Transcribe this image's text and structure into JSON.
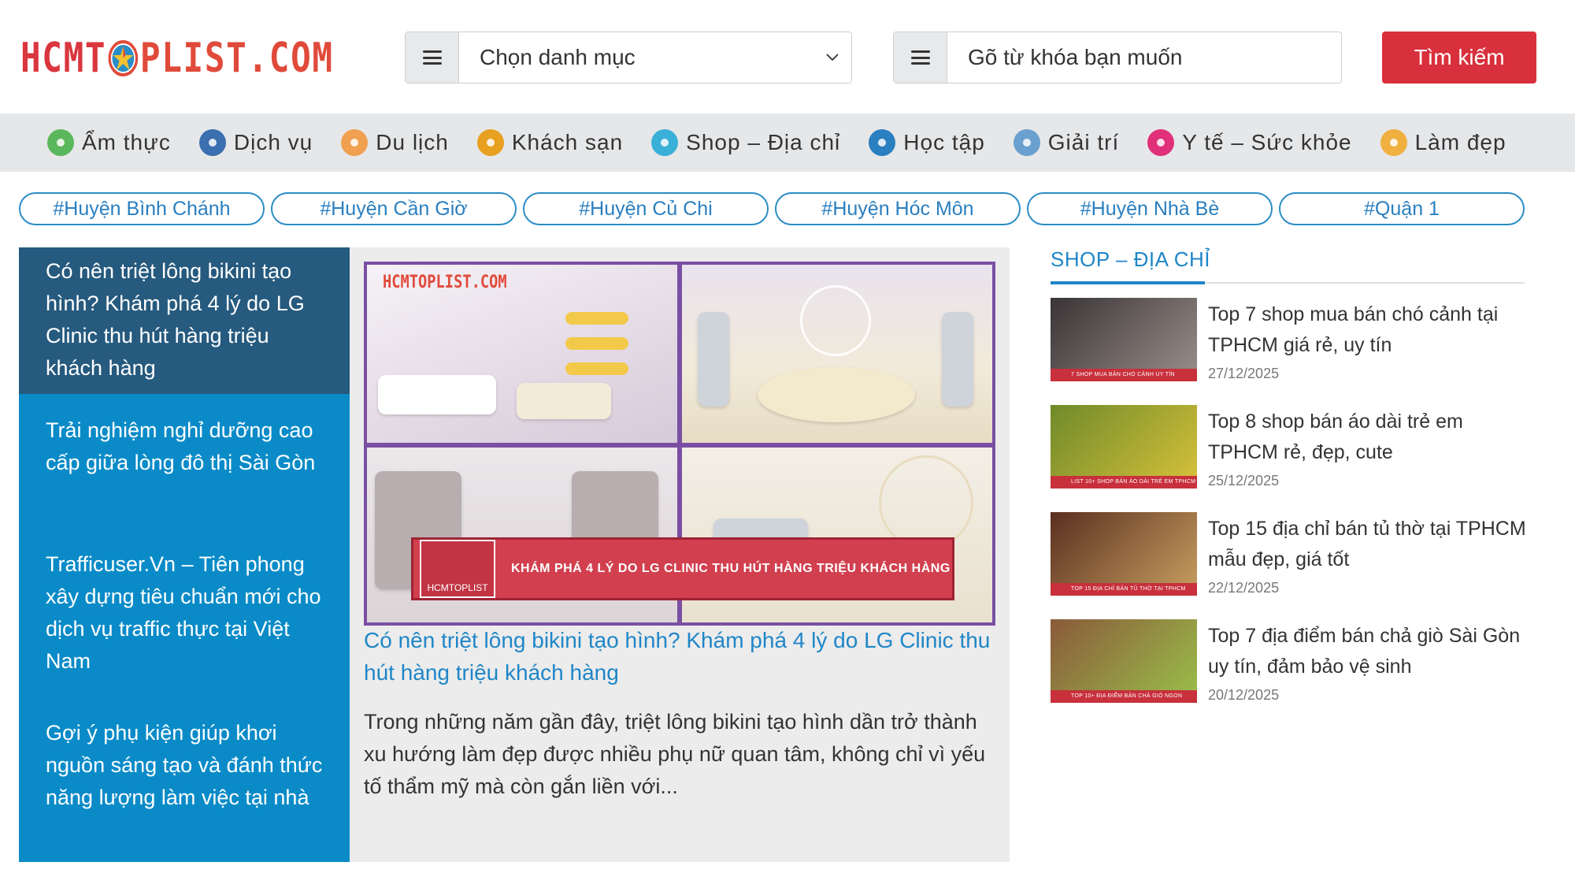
{
  "header": {
    "logo_text_a": "HCMT",
    "logo_text_b": "PLIST.COM",
    "category_select": "Chọn danh mục",
    "search_placeholder": "Gõ từ khóa bạn muốn",
    "search_button": "Tìm kiếm"
  },
  "categories": [
    {
      "label": "Ẩm thực",
      "icon": "food-icon",
      "color": "#5bb75b"
    },
    {
      "label": "Dịch vụ",
      "icon": "service-icon",
      "color": "#3a6fb0"
    },
    {
      "label": "Du lịch",
      "icon": "travel-icon",
      "color": "#f0a050"
    },
    {
      "label": "Khách sạn",
      "icon": "hotel-icon",
      "color": "#e8a020"
    },
    {
      "label": "Shop – Địa chỉ",
      "icon": "shop-icon",
      "color": "#3ab0d8"
    },
    {
      "label": "Học tập",
      "icon": "graduation-icon",
      "color": "#2a7fc0"
    },
    {
      "label": "Giải trí",
      "icon": "amusement-icon",
      "color": "#6aa0d0"
    },
    {
      "label": "Y tế – Sức khỏe",
      "icon": "health-icon",
      "color": "#e0307a"
    },
    {
      "label": "Làm đẹp",
      "icon": "beauty-icon",
      "color": "#f0b040"
    }
  ],
  "tags": [
    "#Huyện Bình Chánh",
    "#Huyện Cần Giờ",
    "#Huyện Củ Chi",
    "#Huyện Hóc Môn",
    "#Huyện Nhà Bè",
    "#Quận 1"
  ],
  "left_posts": [
    "Có nên triệt lông bikini tạo hình? Khám phá 4 lý do LG Clinic thu hút hàng triệu khách hàng",
    "Trải nghiệm nghỉ dưỡng cao cấp giữa lòng đô thị Sài Gòn",
    "Trafficuser.Vn – Tiên phong xây dựng tiêu chuẩn mới cho dịch vụ traffic thực tại Việt Nam",
    "Gợi ý phụ kiện giúp khơi nguồn sáng tạo và đánh thức năng lượng làm việc tại nhà"
  ],
  "featured": {
    "image_watermark": "HCMTOPLIST.COM",
    "banner_logo": "HCMTOPLIST",
    "banner_text": "KHÁM PHÁ 4 LÝ DO LG CLINIC THU HÚT HÀNG TRIỆU KHÁCH HÀNG",
    "title": "Có nên triệt lông bikini tạo hình? Khám phá 4 lý do LG Clinic thu hút hàng triệu khách hàng",
    "excerpt": "Trong những năm gần đây, triệt lông bikini tạo hình dần trở thành xu hướng làm đẹp được nhiều phụ nữ quan tâm, không chỉ vì yếu tố thẩm mỹ mà còn gắn liền với..."
  },
  "sidebar": {
    "title": "SHOP – ĐỊA CHỈ",
    "posts": [
      {
        "title": "Top 7 shop mua bán chó cảnh tại TPHCM giá rẻ, uy tín",
        "date": "27/12/2025",
        "thumb_caption": "7 SHOP MUA BÁN CHÓ CẢNH UY TÍN TPHCM",
        "thumb_colors": [
          "#3a3436",
          "#9a8f8a"
        ]
      },
      {
        "title": "Top 8 shop bán áo dài trẻ em TPHCM rẻ, đẹp, cute",
        "date": "25/12/2025",
        "thumb_caption": "LIST 10+ SHOP BÁN ÁO DÀI TRẺ EM TPHCM",
        "thumb_colors": [
          "#6f8a2a",
          "#d8c23a"
        ]
      },
      {
        "title": "Top 15 địa chỉ bán tủ thờ tại TPHCM mẫu đẹp, giá tốt",
        "date": "22/12/2025",
        "thumb_caption": "TOP 15 ĐỊA CHỈ BÁN TỦ THỜ TẠI TPHCM",
        "thumb_colors": [
          "#5a3020",
          "#c8a060"
        ]
      },
      {
        "title": "Top 7 địa điểm bán chả giò Sài Gòn uy tín, đảm bảo vệ sinh",
        "date": "20/12/2025",
        "thumb_caption": "TOP 10+ ĐỊA ĐIỂM BÁN CHẢ GIÒ NGON NHẤT SÀI GÒN",
        "thumb_colors": [
          "#8a5a3a",
          "#9ac04a"
        ]
      }
    ]
  },
  "colors": {
    "accent_red": "#d8303c",
    "accent_blue": "#1f86c7",
    "list_blue": "#0a8bc8",
    "list_active": "#265a7e"
  }
}
